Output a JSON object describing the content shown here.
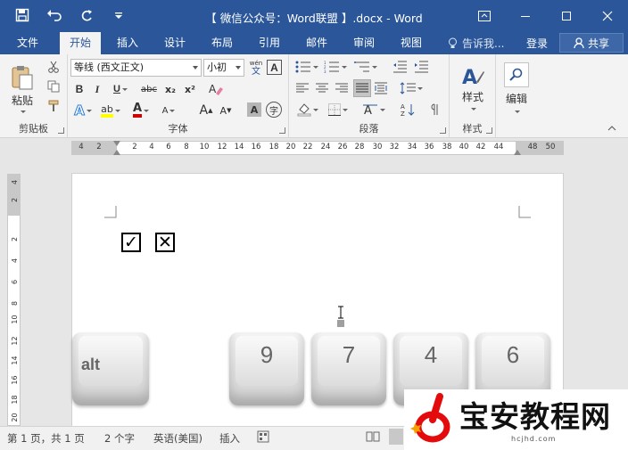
{
  "titlebar": {
    "title": "【 微信公众号：Word联盟 】.docx  -  Word",
    "icons": [
      "save-icon",
      "undo-icon",
      "redo-icon",
      "customize-icon",
      "ribbon-display-icon",
      "minimize-icon",
      "maximize-icon",
      "close-icon"
    ]
  },
  "tabs": {
    "file": "文件",
    "home": "开始",
    "insert": "插入",
    "design": "设计",
    "layout": "布局",
    "references": "引用",
    "mailings": "邮件",
    "review": "审阅",
    "view": "视图",
    "tell_me": "告诉我...",
    "login": "登录",
    "share": "共享"
  },
  "ribbon": {
    "clipboard": {
      "label": "剪贴板",
      "paste": "粘贴"
    },
    "font": {
      "label": "字体",
      "font_name": "等线 (西文正文)",
      "font_size": "小初",
      "bold": "B",
      "italic": "I",
      "underline": "U",
      "strike": "abc",
      "subscript": "x₂",
      "superscript": "x²",
      "grow": "A",
      "shrink": "A",
      "phonetic_top": "wén",
      "phonetic_bottom": "文",
      "border_char": "A",
      "enclose_char": "字",
      "shading_char": "A",
      "font_color": "A",
      "text_effects": "A",
      "highlight": "ab"
    },
    "paragraph": {
      "label": "段落"
    },
    "styles": {
      "label": "样式",
      "button": "样式"
    },
    "editing": {
      "button": "编辑"
    }
  },
  "ruler": {
    "h_numbers": [
      "4",
      "2",
      "2",
      "4",
      "6",
      "8",
      "10",
      "12",
      "14",
      "16",
      "18",
      "20",
      "22",
      "24",
      "26",
      "28",
      "30",
      "32",
      "34",
      "36",
      "38",
      "40",
      "42",
      "44",
      "48",
      "50"
    ],
    "v_numbers": [
      "4",
      "2",
      "2",
      "4",
      "6",
      "8",
      "10",
      "12",
      "14",
      "16",
      "18",
      "20"
    ]
  },
  "document": {
    "checkbox_checked": "✓",
    "checkbox_crossed": "✕",
    "keys": [
      "alt",
      "9",
      "7",
      "4",
      "6"
    ]
  },
  "status": {
    "page": "第 1 页，共 1 页",
    "words": "2 个字",
    "language": "英语(美国)",
    "mode": "插入"
  },
  "watermark": {
    "brand": "宝安教程网",
    "url": "hcjhd.com"
  },
  "colors": {
    "accent": "#2b579a",
    "highlight": "#ffff00",
    "font_color": "#d00000"
  }
}
